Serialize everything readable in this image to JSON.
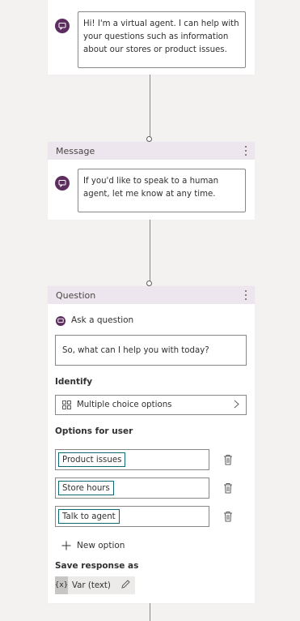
{
  "intro_card": {
    "text": "Hi! I'm a virtual agent. I can help with your questions such as information about our stores or product issues."
  },
  "message_card": {
    "title": "Message",
    "text": "If you'd like to speak to a human agent, let me know at any time."
  },
  "question_card": {
    "title": "Question",
    "ask_label": "Ask a question",
    "question_text": "So, what can I help you with today?",
    "identify_label": "Identify",
    "identify_value": "Multiple choice options",
    "options_label": "Options for user",
    "options": [
      "Product issues",
      "Store hours",
      "Talk to agent"
    ],
    "new_option_label": "New option",
    "save_label": "Save response as",
    "var_tag": "{x}",
    "var_value": "Var (text)"
  },
  "colors": {
    "bot_icon": "#5c2d5e",
    "header_bg": "#ede6ef",
    "chip_border": "#0e6a72",
    "canvas_bg": "#f3f2f1"
  },
  "icons": [
    "chat-bubble-icon",
    "more-vertical-icon",
    "choice-grid-icon",
    "chevron-right-icon",
    "trash-icon",
    "plus-icon",
    "pencil-icon"
  ]
}
